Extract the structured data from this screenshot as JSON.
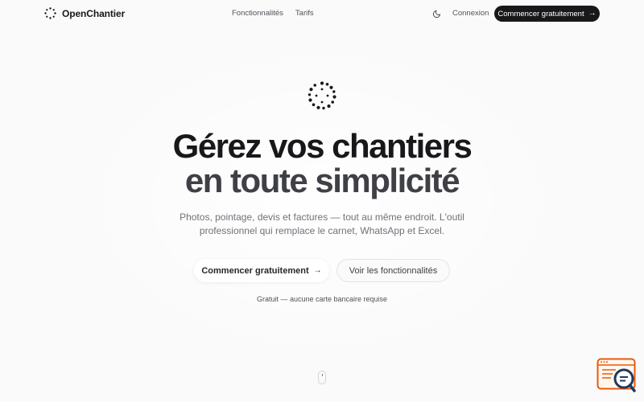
{
  "header": {
    "brand_name": "OpenChantier",
    "nav": [
      "Fonctionnalités",
      "Tarifs"
    ],
    "login_label": "Connexion",
    "cta_label": "Commencer gratuitement",
    "cta_arrow": "→"
  },
  "hero": {
    "title_line1": "Gérez vos chantiers",
    "title_line2": "en toute simplicité",
    "subtitle": "Photos, pointage, devis et factures — tout au même endroit. L'outil professionnel qui remplace le carnet, WhatsApp et Excel.",
    "primary_button": "Commencer gratuitement",
    "primary_arrow": "→",
    "secondary_button": "Voir les fonctionnalités",
    "note": "Gratuit — aucune carte bancaire requise"
  },
  "icons": {
    "brand": "dotted-circle-logo-icon",
    "theme": "moon-icon",
    "scroll": "mouse-scroll-icon",
    "widget": "chat-search-widget-icon"
  },
  "colors": {
    "primary": "#18181b",
    "background": "#fafafa",
    "muted": "#71717a",
    "widget_accent": "#ea580c",
    "widget_dark": "#1e3a5f"
  }
}
